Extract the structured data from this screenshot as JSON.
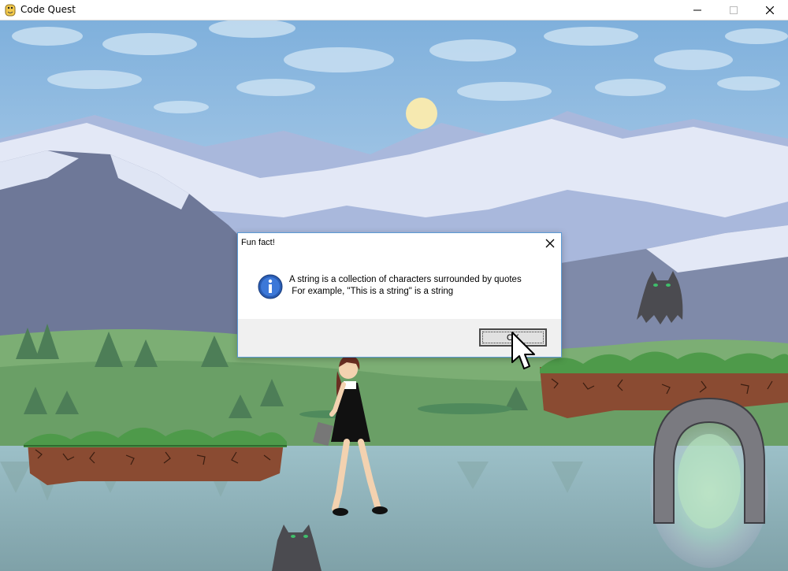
{
  "window": {
    "title": "Code Quest",
    "app_icon": "snake-icon",
    "controls": [
      "minimize-icon",
      "maximize-icon",
      "close-icon"
    ]
  },
  "dialog": {
    "title": "Fun fact!",
    "icon": "info-icon",
    "message": "A string is a collection of characters surrounded by quotes\n For example, \"This is a string\" is a string",
    "ok_label": "OK"
  },
  "scene": {
    "objects": [
      "sun",
      "mountains",
      "lake",
      "grass-platform-left",
      "grass-platform-right",
      "player-girl",
      "ghost-cat-top",
      "ghost-cat-bottom",
      "stone-portal"
    ],
    "colors": {
      "sky": "#a6c8e6",
      "grass": "#5ea45a",
      "dirt": "#8a4b32",
      "water": "#8fb0b8"
    }
  }
}
